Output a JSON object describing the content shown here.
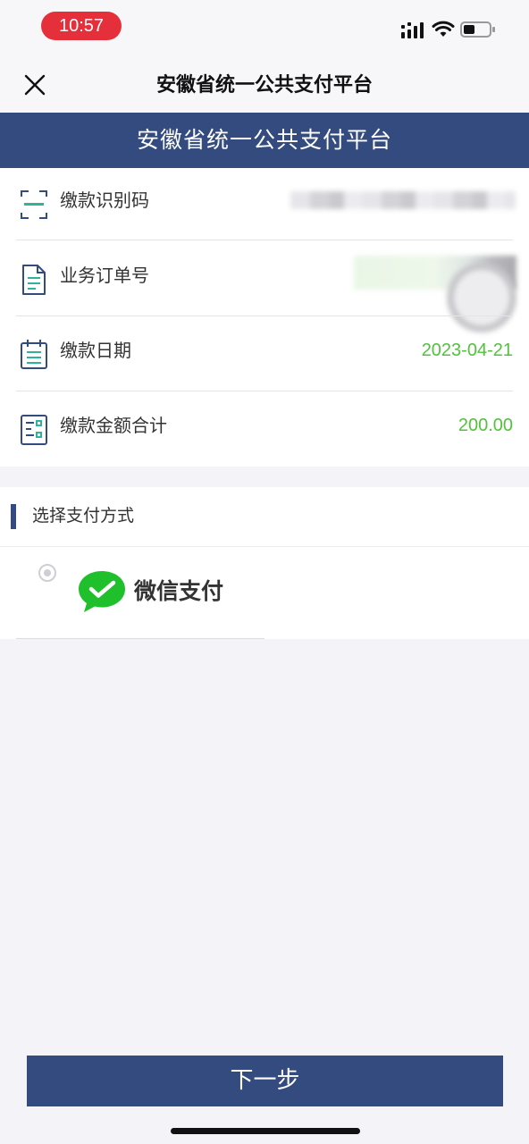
{
  "status_bar": {
    "time": "10:57"
  },
  "nav": {
    "title": "安徽省统一公共支付平台",
    "close_icon": "close-icon"
  },
  "banner": {
    "title": "安徽省统一公共支付平台"
  },
  "info": {
    "rows": [
      {
        "icon": "scan-code-icon",
        "label": "缴款识别码",
        "value": ""
      },
      {
        "icon": "document-icon",
        "label": "业务订单号",
        "value": ""
      },
      {
        "icon": "calendar-icon",
        "label": "缴款日期",
        "value": "2023-04-21"
      },
      {
        "icon": "receipt-icon",
        "label": "缴款金额合计",
        "value": "200.00"
      }
    ]
  },
  "payment": {
    "section_title": "选择支付方式",
    "options": [
      {
        "icon": "wechat-pay-icon",
        "label": "微信支付",
        "selected": false
      }
    ]
  },
  "actions": {
    "next_label": "下一步"
  },
  "colors": {
    "primary": "#334b7e",
    "value_green": "#52c23c",
    "time_pill": "#e5303c",
    "wechat_green": "#1fc02b"
  }
}
